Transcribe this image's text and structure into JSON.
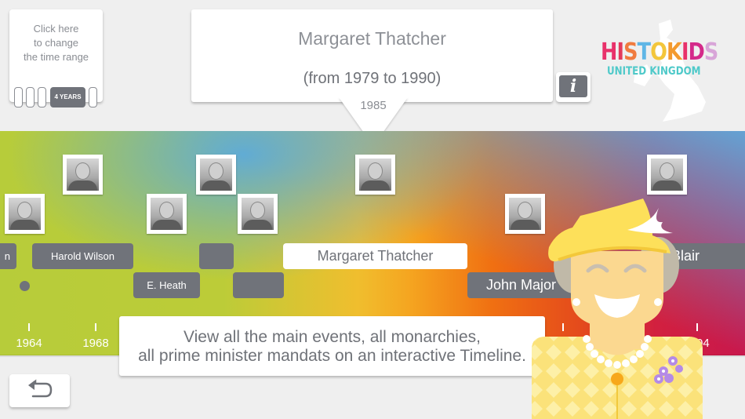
{
  "range_selector": {
    "prompt": "Click here\nto change\nthe time range",
    "prompt_lines": [
      "Click here",
      "to change",
      "the time range"
    ],
    "selected": "4 YEARS"
  },
  "popup": {
    "name": "Margaret Thatcher",
    "range": "(from 1979 to 1990)",
    "current_year": "1985"
  },
  "info_button": {
    "label": "i"
  },
  "logo": {
    "title_letters": [
      {
        "ch": "H",
        "color": "#e8316a"
      },
      {
        "ch": "I",
        "color": "#e33a5c"
      },
      {
        "ch": "S",
        "color": "#f07b3f"
      },
      {
        "ch": "T",
        "color": "#5fb6e6"
      },
      {
        "ch": "O",
        "color": "#f3c63b"
      },
      {
        "ch": "K",
        "color": "#f39a2e"
      },
      {
        "ch": "I",
        "color": "#e8316a"
      },
      {
        "ch": "D",
        "color": "#d42a8a"
      },
      {
        "ch": "S",
        "color": "#d8a5d8"
      }
    ],
    "subtitle": "UNITED KINGDOM"
  },
  "timeline": {
    "prime_ministers": [
      {
        "label": "n",
        "row": 1
      },
      {
        "label": "Harold Wilson",
        "row": 1
      },
      {
        "label": "E. Heath",
        "row": 2
      },
      {
        "label": "",
        "row": 1
      },
      {
        "label": "",
        "row": 2
      },
      {
        "label": "Margaret Thatcher",
        "row": 1,
        "selected": true
      },
      {
        "label": "John Major",
        "row": 2
      },
      {
        "label": "Blair",
        "row": 1
      }
    ],
    "ticks": [
      "1964",
      "1968",
      "",
      "",
      "",
      "",
      "",
      "",
      "2004"
    ],
    "tick_labels_visible": [
      "1964",
      "1968",
      "04"
    ]
  },
  "caption": {
    "line1": "View all the main events, all monarchies,",
    "line2": "all prime minister mandats on an interactive Timeline."
  },
  "back_button": {
    "icon": "back-arrow-icon"
  }
}
